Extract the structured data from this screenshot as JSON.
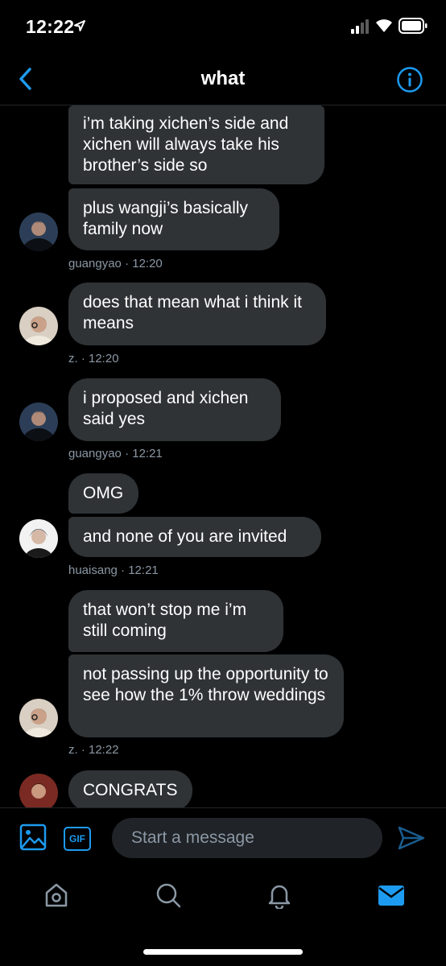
{
  "status_bar": {
    "time": "12:22"
  },
  "header": {
    "title": "what"
  },
  "messages": [
    {
      "text": "i’m taking xichen’s side and xichen will always take his brother’s side so"
    },
    {
      "text": "plus wangji’s basically family now"
    },
    {
      "text": "does that mean what i think it means"
    },
    {
      "text": "i proposed and xichen said yes"
    },
    {
      "text": "OMG"
    },
    {
      "text": "and none of you are invited"
    },
    {
      "text": "that won’t stop me i’m still coming"
    },
    {
      "text": "not passing up the opportunity to see how the 1% throw weddings"
    },
    {
      "text": "CONGRATS"
    }
  ],
  "meta": [
    "guangyao · 12:20",
    "z. · 12:20",
    "guangyao · 12:21",
    "huaisang  · 12:21",
    "z. · 12:22"
  ],
  "composer": {
    "placeholder": "Start a message",
    "gif_label": "GIF"
  },
  "colors": {
    "accent": "#1d9bf0",
    "bubble": "#2f3336",
    "meta": "#8b98a5",
    "background": "#000000"
  }
}
